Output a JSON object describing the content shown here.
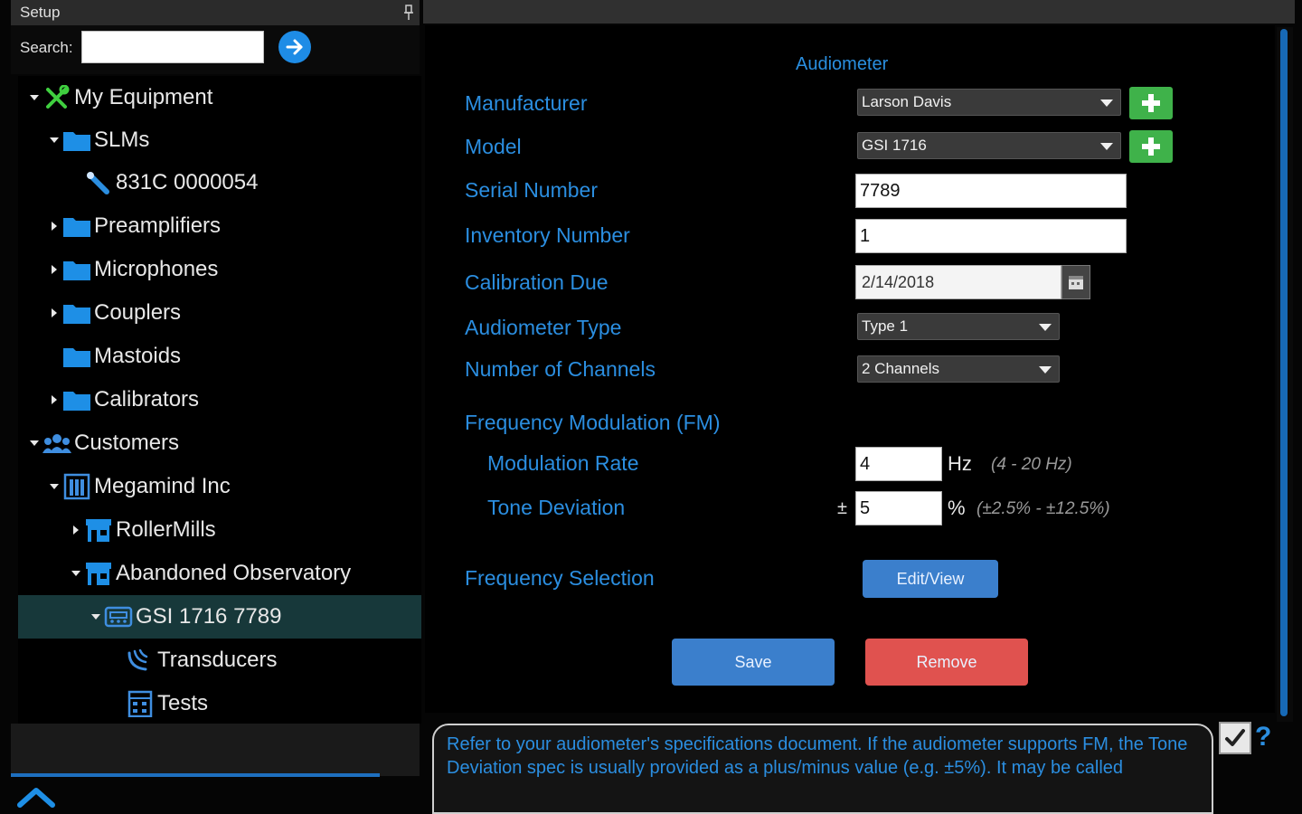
{
  "setup": {
    "title": "Setup",
    "search_label": "Search:",
    "search_value": ""
  },
  "tree": {
    "items": [
      {
        "label": "My Equipment",
        "icon": "tools-icon"
      },
      {
        "label": "SLMs",
        "icon": "folder-icon"
      },
      {
        "label": "831C 0000054",
        "icon": "slm-device-icon"
      },
      {
        "label": "Preamplifiers",
        "icon": "folder-icon"
      },
      {
        "label": "Microphones",
        "icon": "folder-icon"
      },
      {
        "label": "Couplers",
        "icon": "folder-icon"
      },
      {
        "label": "Mastoids",
        "icon": "folder-icon"
      },
      {
        "label": "Calibrators",
        "icon": "folder-icon"
      },
      {
        "label": "Customers",
        "icon": "customers-icon"
      },
      {
        "label": "Megamind Inc",
        "icon": "building-icon"
      },
      {
        "label": "RollerMills",
        "icon": "store-icon"
      },
      {
        "label": "Abandoned Observatory",
        "icon": "store-icon"
      },
      {
        "label": "GSI 1716 7789",
        "icon": "audiometer-icon"
      },
      {
        "label": "Transducers",
        "icon": "transducer-icon"
      },
      {
        "label": "Tests",
        "icon": "tests-icon"
      }
    ]
  },
  "form": {
    "title": "Audiometer",
    "manufacturer": {
      "label": "Manufacturer",
      "value": "Larson Davis"
    },
    "model": {
      "label": "Model",
      "value": "GSI 1716"
    },
    "serial_number": {
      "label": "Serial Number",
      "value": "7789"
    },
    "inventory_number": {
      "label": "Inventory Number",
      "value": "1"
    },
    "calibration_due": {
      "label": "Calibration Due",
      "value": "2/14/2018"
    },
    "audiometer_type": {
      "label": "Audiometer Type",
      "value": "Type 1"
    },
    "channels": {
      "label": "Number of Channels",
      "value": "2 Channels"
    },
    "fm_heading": "Frequency Modulation (FM)",
    "modulation_rate": {
      "label": "Modulation Rate",
      "value": "4",
      "unit": "Hz",
      "hint": "(4 - 20 Hz)"
    },
    "tone_deviation": {
      "label": "Tone Deviation",
      "prefix": "±",
      "value": "5",
      "unit": "%",
      "hint": "(±2.5% - ±12.5%)"
    },
    "frequency_selection": {
      "label": "Frequency Selection",
      "button": "Edit/View"
    },
    "save_label": "Save",
    "remove_label": "Remove"
  },
  "help": {
    "text": "Refer to your audiometer's specifications document. If the audiometer supports FM, the Tone Deviation spec is usually provided as a plus/minus value (e.g. ±5%). It may be called"
  },
  "colors": {
    "accent": "#2b8ee0",
    "add_green": "#3fb24a",
    "remove_red": "#e0524f",
    "selected_row": "#17383a"
  }
}
